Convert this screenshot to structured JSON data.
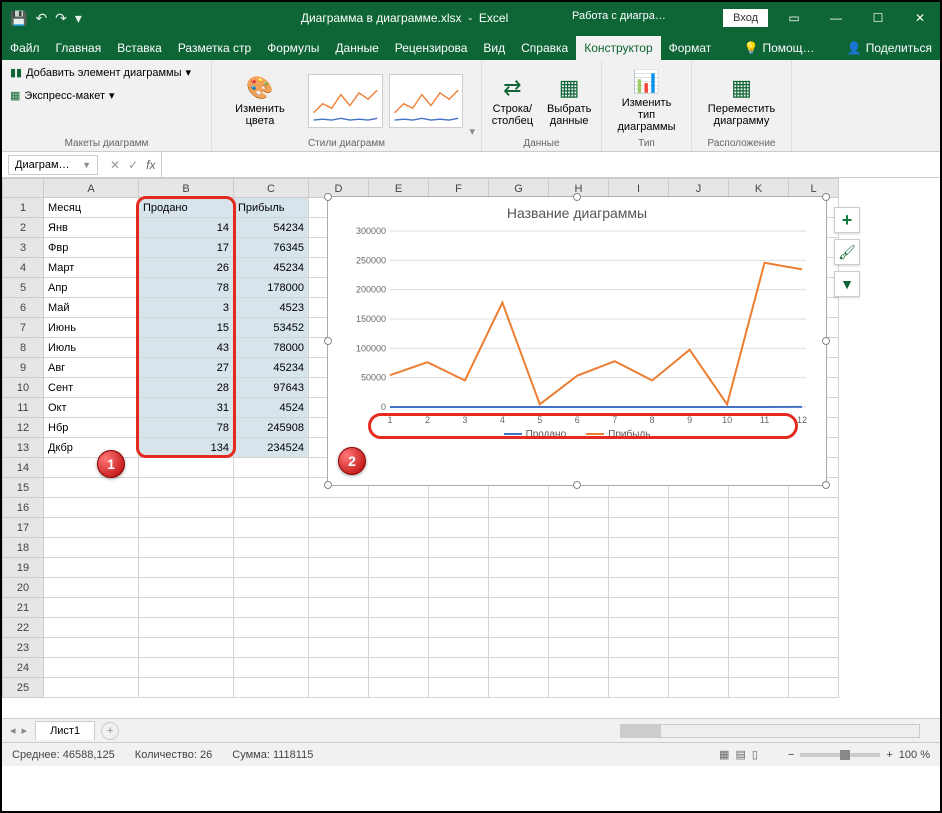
{
  "title": {
    "filename": "Диаграмма в диаграмме.xlsx",
    "app": "Excel",
    "context": "Работа с диагра…",
    "login": "Вход"
  },
  "tabs": {
    "file": "Файл",
    "home": "Главная",
    "insert": "Вставка",
    "pageLayout": "Разметка стр",
    "formulas": "Формулы",
    "data": "Данные",
    "review": "Рецензирова",
    "view": "Вид",
    "help": "Справка",
    "designer": "Конструктор",
    "format": "Формат",
    "tellme": "Помощ…",
    "share": "Поделиться"
  },
  "ribbon": {
    "layoutsGroup": "Макеты диаграмм",
    "addChartElement": "Добавить элемент диаграммы",
    "expressLayout": "Экспресс-макет",
    "stylesGroup": "Стили диаграмм",
    "changeColors": "Изменить цвета",
    "dataGroup": "Данные",
    "rowCol": "Строка/ столбец",
    "selectData": "Выбрать данные",
    "typeGroup": "Тип",
    "changeType": "Изменить тип диаграммы",
    "locationGroup": "Расположение",
    "move": "Переместить диаграмму"
  },
  "namebox": "Диаграм…",
  "columns": [
    "A",
    "B",
    "C",
    "D",
    "E",
    "F",
    "G",
    "H",
    "I",
    "J",
    "K",
    "L"
  ],
  "headers": {
    "A": "Месяц",
    "B": "Продано",
    "C": "Прибыль"
  },
  "rows": [
    {
      "A": "Янв",
      "B": 14,
      "C": 54234
    },
    {
      "A": "Фвр",
      "B": 17,
      "C": 76345
    },
    {
      "A": "Март",
      "B": 26,
      "C": 45234
    },
    {
      "A": "Апр",
      "B": 78,
      "C": 178000
    },
    {
      "A": "Май",
      "B": 3,
      "C": 4523
    },
    {
      "A": "Июнь",
      "B": 15,
      "C": 53452
    },
    {
      "A": "Июль",
      "B": 43,
      "C": 78000
    },
    {
      "A": "Авг",
      "B": 27,
      "C": 45234
    },
    {
      "A": "Сент",
      "B": 28,
      "C": 97643
    },
    {
      "A": "Окт",
      "B": 31,
      "C": 4524
    },
    {
      "A": "Нбр",
      "B": 78,
      "C": 245908
    },
    {
      "A": "Дкбр",
      "B": 134,
      "C": 234524
    }
  ],
  "chart_data": {
    "type": "line",
    "title": "Название диаграммы",
    "categories": [
      1,
      2,
      3,
      4,
      5,
      6,
      7,
      8,
      9,
      10,
      11,
      12
    ],
    "series": [
      {
        "name": "Продано",
        "color": "#4472c4",
        "values": [
          14,
          17,
          26,
          78,
          3,
          15,
          43,
          27,
          28,
          31,
          78,
          134
        ]
      },
      {
        "name": "Прибыль",
        "color": "#ed7d31",
        "values": [
          54234,
          76345,
          45234,
          178000,
          4523,
          53452,
          78000,
          45234,
          97643,
          4524,
          245908,
          234524
        ]
      }
    ],
    "ylim": [
      0,
      300000
    ],
    "yticks": [
      0,
      50000,
      100000,
      150000,
      200000,
      250000,
      300000
    ]
  },
  "legend": {
    "sold": "Продано",
    "profit": "Прибыль"
  },
  "sheetTab": "Лист1",
  "status": {
    "avgLabel": "Среднее:",
    "avg": "46588,125",
    "countLabel": "Количество:",
    "count": "26",
    "sumLabel": "Сумма:",
    "sum": "1118115",
    "zoom": "100 %"
  },
  "callouts": {
    "one": "1",
    "two": "2"
  }
}
